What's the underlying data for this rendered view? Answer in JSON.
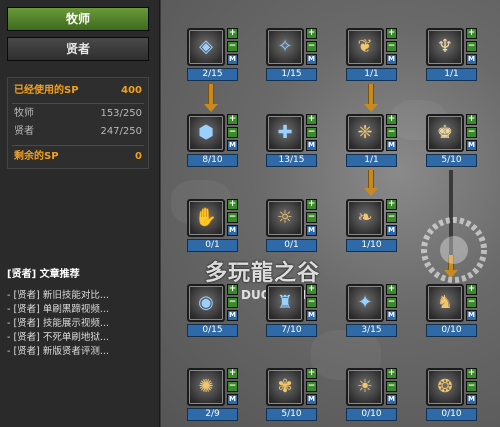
{
  "tabs": {
    "class_primary": "牧师",
    "class_secondary": "贤者"
  },
  "sp": {
    "used_label": "已经使用的SP",
    "used_value": "400",
    "priest_label": "牧师",
    "priest_value": "153/250",
    "sage_label": "贤者",
    "sage_value": "247/250",
    "remaining_label": "剩余的SP",
    "remaining_value": "0"
  },
  "articles": {
    "title": "[贤者] 文章推荐",
    "items": [
      "- [贤者] 新旧技能对比...",
      "- [贤者] 单刷黑蹄视频...",
      "- [贤者] 技能展示视频...",
      "- [贤者] 不死单刷地狱...",
      "- [贤者] 新版贤者评测..."
    ]
  },
  "buttons": {
    "plus": "+",
    "minus": "−",
    "m": "M"
  },
  "skills": [
    {
      "level": "2/15",
      "icon": "shield-icon",
      "glyph": "◈",
      "color": "#9ad0ff"
    },
    {
      "level": "1/15",
      "icon": "ice-spirit-icon",
      "glyph": "✧",
      "color": "#8ecbff"
    },
    {
      "level": "1/1",
      "icon": "phoenix-icon",
      "glyph": "❦",
      "color": "#f3c66b"
    },
    {
      "level": "1/1",
      "icon": "goddess-icon",
      "glyph": "♆",
      "color": "#f0d8a0"
    },
    {
      "level": "8/10",
      "icon": "barrier-icon",
      "glyph": "⬢",
      "color": "#9ad0ff"
    },
    {
      "level": "13/15",
      "icon": "cross-icon",
      "glyph": "✚",
      "color": "#9ad0ff"
    },
    {
      "level": "1/1",
      "icon": "wings-icon",
      "glyph": "❈",
      "color": "#f3c66b"
    },
    {
      "level": "5/10",
      "icon": "angel-icon",
      "glyph": "♚",
      "color": "#f0d8a0"
    },
    {
      "level": "0/1",
      "icon": "hand-icon",
      "glyph": "✋",
      "color": "#f3c66b"
    },
    {
      "level": "0/1",
      "icon": "spirit-icon",
      "glyph": "☼",
      "color": "#f3c66b"
    },
    {
      "level": "1/10",
      "icon": "bird-icon",
      "glyph": "❧",
      "color": "#f3c66b"
    },
    {
      "level": "0/15",
      "icon": "orb-icon",
      "glyph": "◉",
      "color": "#9ad0ff"
    },
    {
      "level": "7/10",
      "icon": "tower-icon",
      "glyph": "♜",
      "color": "#9ad0ff"
    },
    {
      "level": "3/15",
      "icon": "star-orb-icon",
      "glyph": "✦",
      "color": "#9ad0ff"
    },
    {
      "level": "0/10",
      "icon": "dragon-icon",
      "glyph": "♞",
      "color": "#f3c66b"
    },
    {
      "level": "2/9",
      "icon": "flame-icon",
      "glyph": "✺",
      "color": "#f3c66b"
    },
    {
      "level": "5/10",
      "icon": "fairy-icon",
      "glyph": "✾",
      "color": "#f3c66b"
    },
    {
      "level": "0/10",
      "icon": "sun-icon",
      "glyph": "☀",
      "color": "#f3c66b"
    },
    {
      "level": "0/10",
      "icon": "swirl-icon",
      "glyph": "❂",
      "color": "#f3c66b"
    }
  ],
  "watermark": {
    "text": "多玩龍之谷",
    "sub": "DUO COM"
  }
}
